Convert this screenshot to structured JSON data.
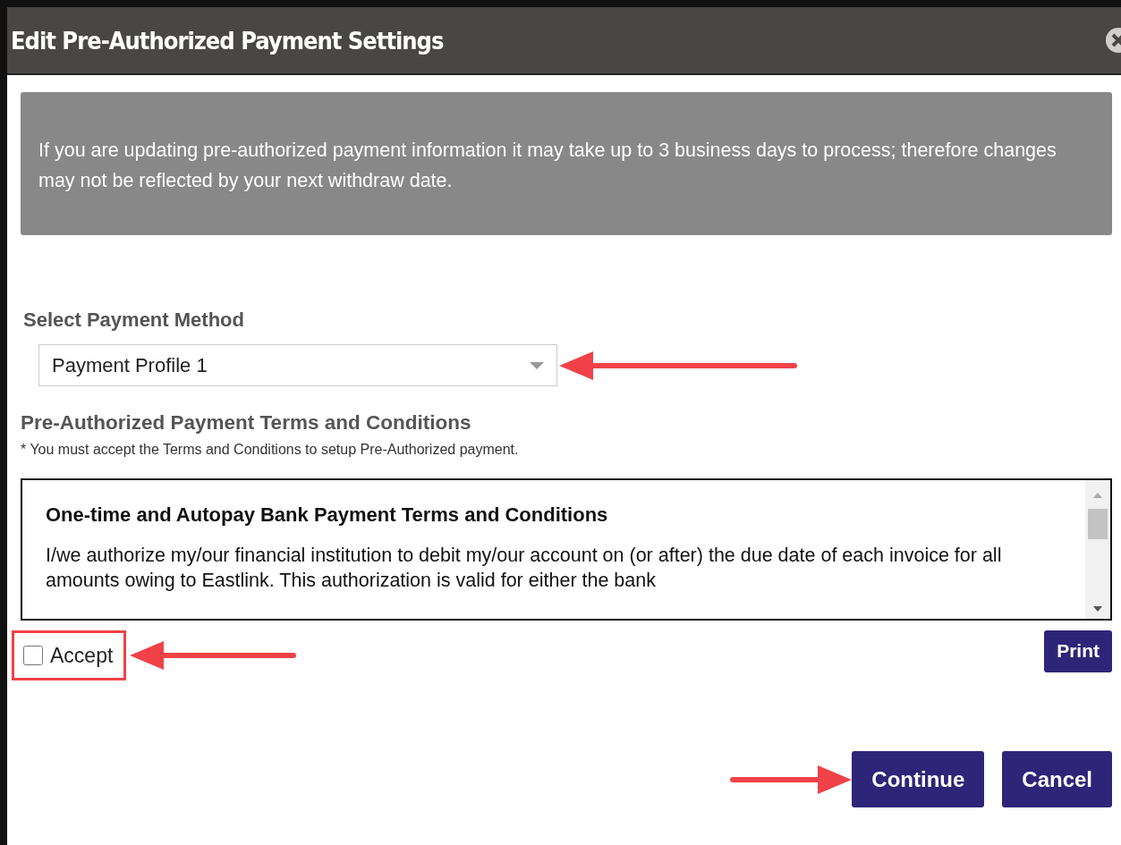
{
  "window": {
    "title": "Edit Pre-Authorized Payment Settings"
  },
  "notice": "If you are updating pre-authorized payment information it may take up to 3 business days to process; therefore changes may not be reflected by your next withdraw date.",
  "payment_method": {
    "label": "Select Payment Method",
    "value": "Payment Profile 1"
  },
  "terms": {
    "heading": "Pre-Authorized Payment Terms and Conditions",
    "note": "* You must accept the Terms and Conditions to setup Pre-Authorized payment.",
    "box_title": "One-time and Autopay Bank Payment Terms and Conditions",
    "box_text": "I/we authorize my/our financial institution to debit my/our account on (or after) the due date of each invoice for all amounts owing to Eastlink. This authorization is valid for either the bank"
  },
  "accept": {
    "label": "Accept",
    "checked": false
  },
  "buttons": {
    "print": "Print",
    "continue": "Continue",
    "cancel": "Cancel"
  }
}
